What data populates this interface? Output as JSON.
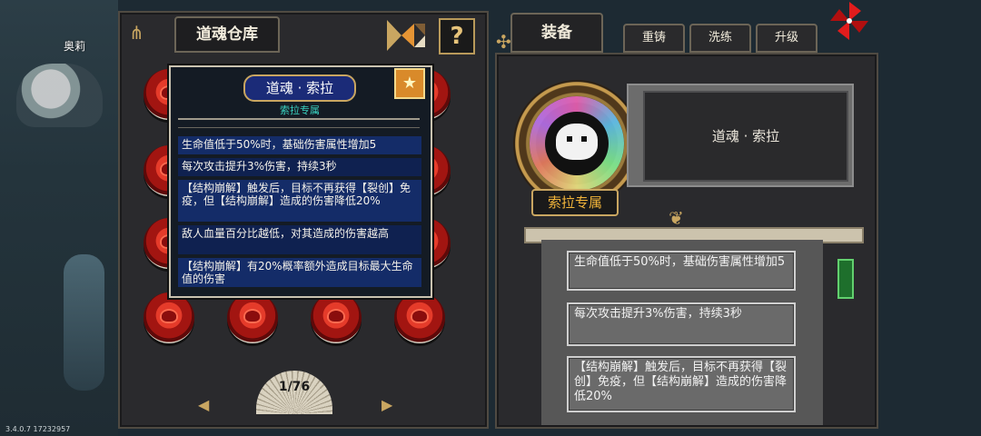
{
  "world": {
    "npc_name": "奥莉",
    "version": "3.4.0.7 17232957"
  },
  "left": {
    "tab_label": "道魂仓库",
    "help_label": "?",
    "page_indicator": "1/76"
  },
  "tooltip": {
    "title": "道魂 · 索拉",
    "subtitle": "索拉专属",
    "effects": [
      "生命值低于50%时，基础伤害属性增加5",
      "每次攻击提升3%伤害，持续3秒",
      "【结构崩解】触发后，目标不再获得【裂创】免疫，但【结构崩解】造成的伤害降低20%",
      "敌人血量百分比越低，对其造成的伤害越高",
      "【结构崩解】有20%概率额外造成目标最大生命值的伤害"
    ]
  },
  "right": {
    "equip_tab": "装备",
    "tabs": [
      "重铸",
      "洗练",
      "升级"
    ],
    "item_name": "道魂 · 索拉",
    "exclusive_tag": "索拉专属",
    "effects": [
      "生命值低于50%时，基础伤害属性增加5",
      "每次攻击提升3%伤害，持续3秒",
      "【结构崩解】触发后，目标不再获得【裂创】免疫，但【结构崩解】造成的伤害降低20%"
    ]
  },
  "colors": {
    "accent_gold": "#c9a661",
    "tooltip_blue": "#142c68",
    "cyan_subtitle": "#3ad2c0",
    "orange_tag": "#f0b33a"
  },
  "icons": [
    "menu-icon",
    "tangram-icon",
    "help-icon",
    "pinwheel-icon",
    "star-icon",
    "prev-arrow-icon",
    "next-arrow-icon"
  ]
}
